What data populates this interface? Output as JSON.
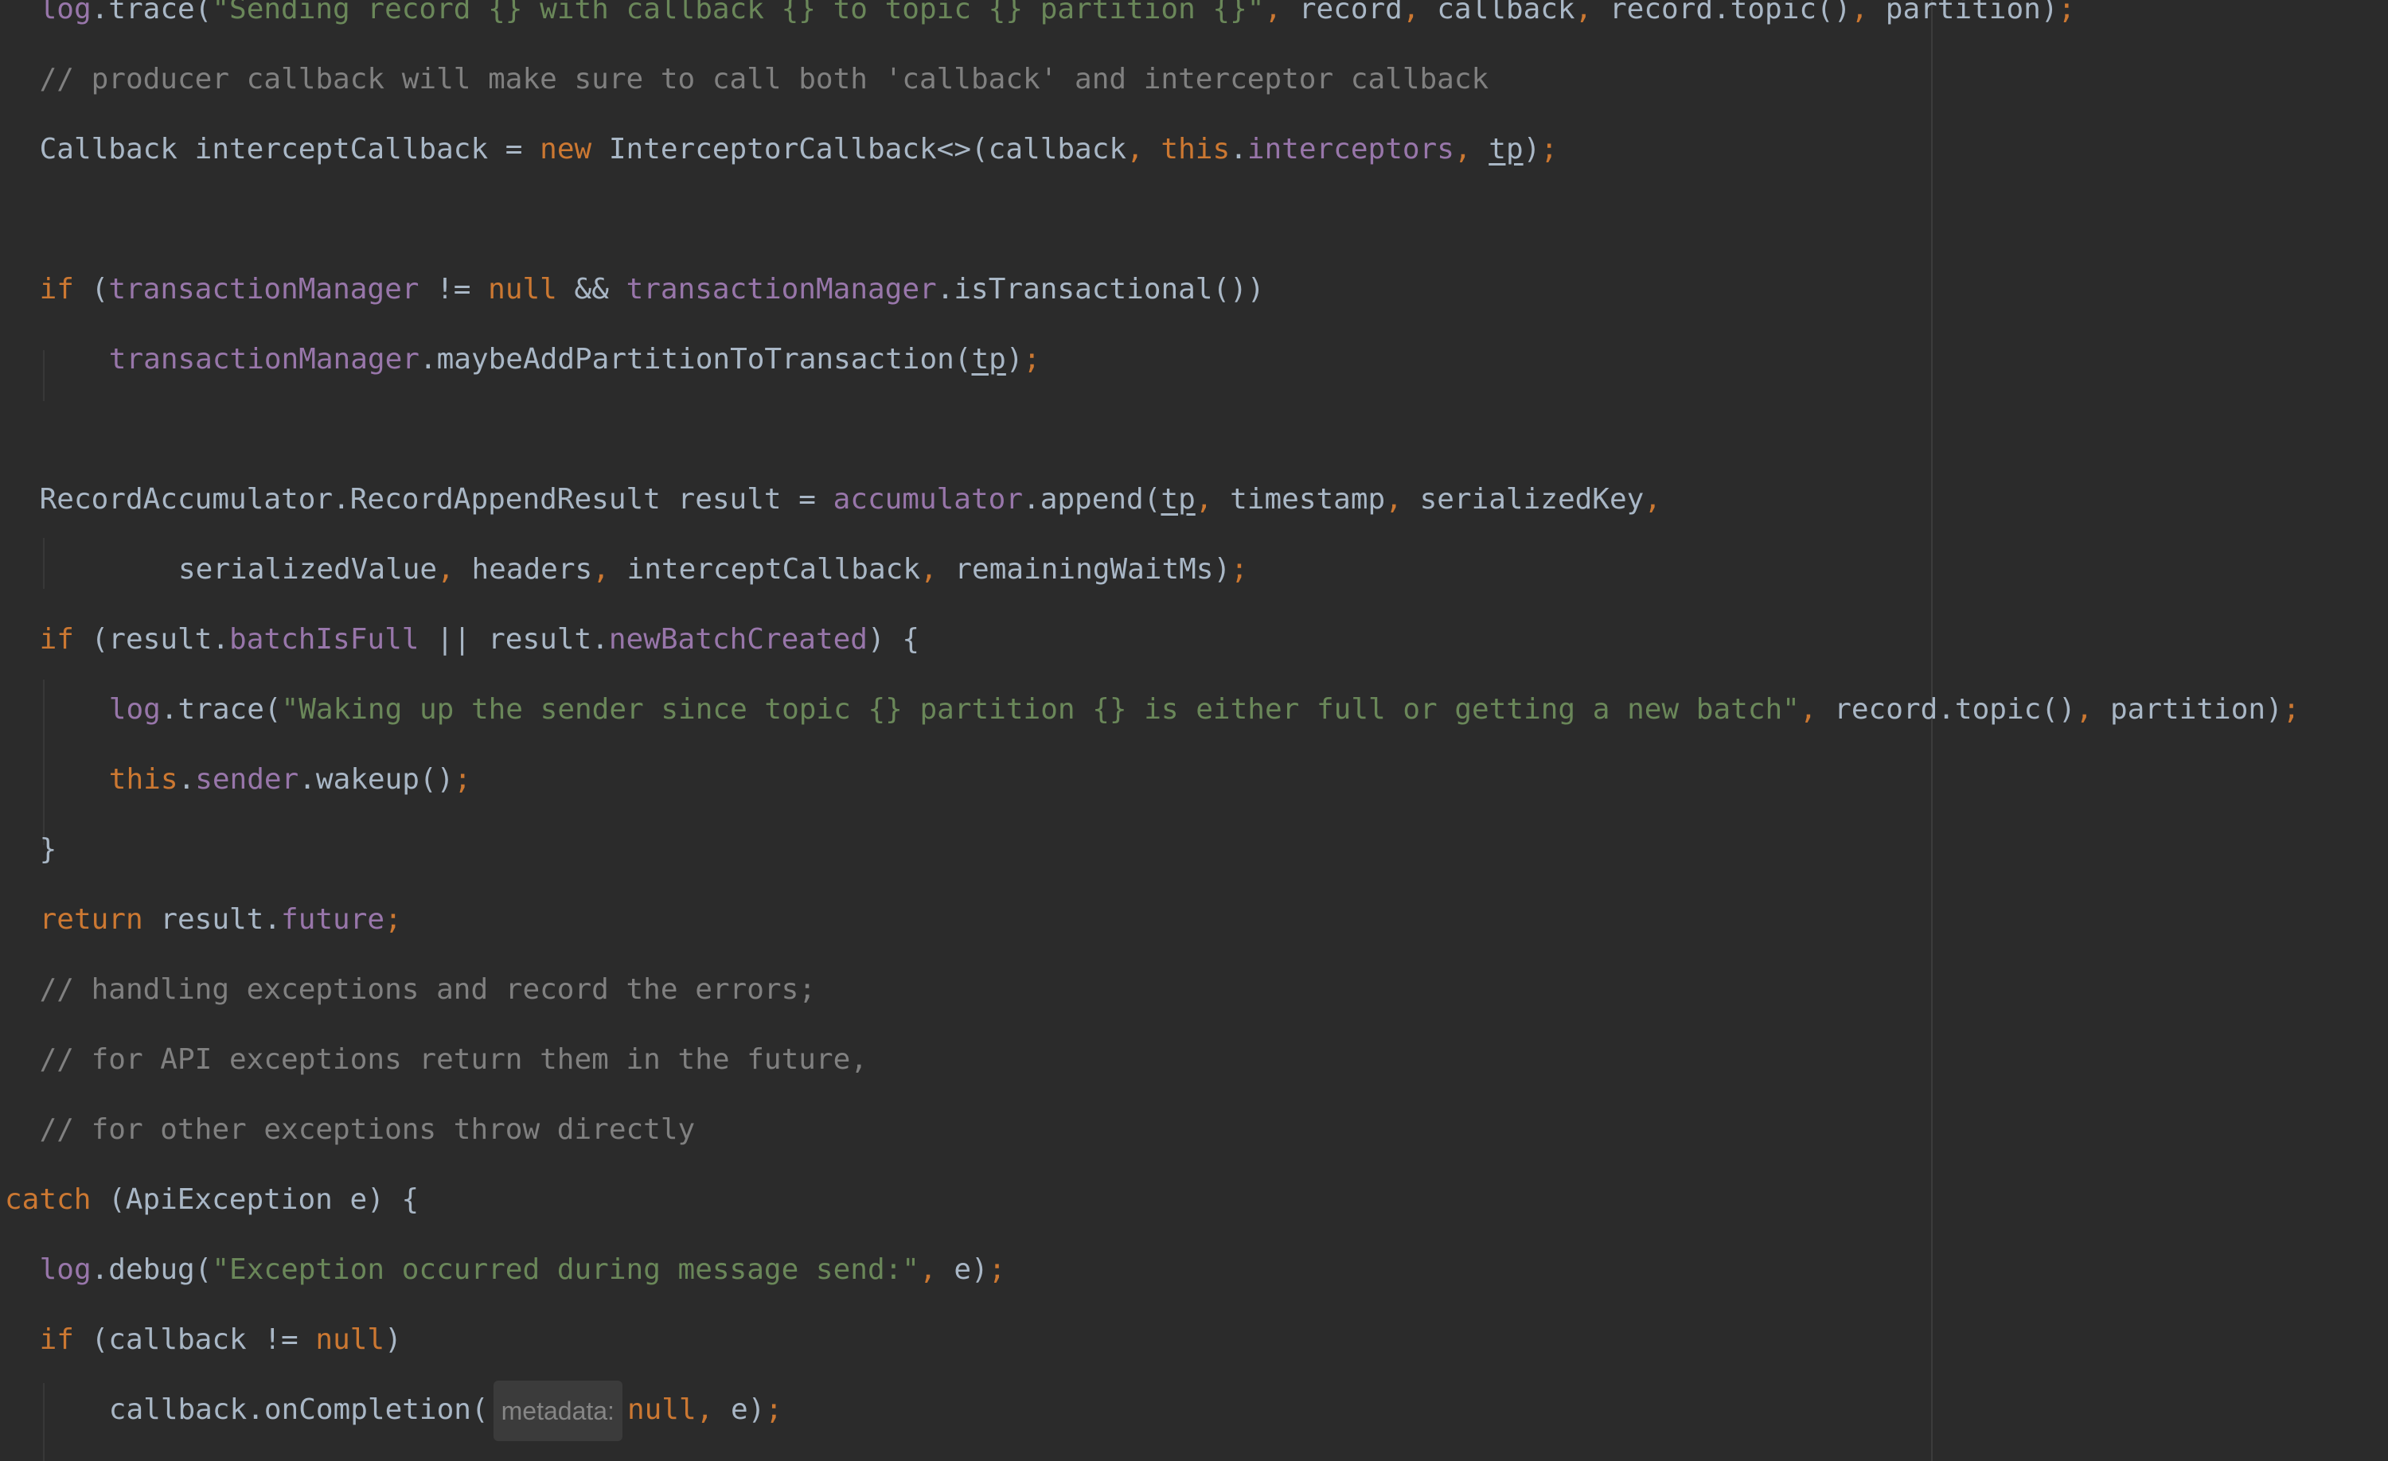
{
  "editor": {
    "colors": {
      "background": "#2b2b2b",
      "plain": "#a9b7c6",
      "keyword": "#cc7832",
      "field": "#9876aa",
      "string": "#6a8759",
      "comment": "#808080",
      "hint_background": "#3b3b3b",
      "hint_text": "#868686"
    },
    "lines": [
      {
        "indent": "  ",
        "tokens": [
          {
            "t": "field",
            "s": "log"
          },
          {
            "t": "plain",
            "s": ".trace("
          },
          {
            "t": "string",
            "s": "\"Sending record {} with callback {} to topic {} partition {}\""
          },
          {
            "t": "punct",
            "s": ", "
          },
          {
            "t": "plain",
            "s": "record"
          },
          {
            "t": "punct",
            "s": ", "
          },
          {
            "t": "plain",
            "s": "callback"
          },
          {
            "t": "punct",
            "s": ", "
          },
          {
            "t": "plain",
            "s": "record.topic()"
          },
          {
            "t": "punct",
            "s": ", "
          },
          {
            "t": "plain",
            "s": "partition)"
          },
          {
            "t": "punct",
            "s": ";"
          }
        ]
      },
      {
        "indent": "  ",
        "tokens": [
          {
            "t": "comment",
            "s": "// producer callback will make sure to call both 'callback' and interceptor callback"
          }
        ]
      },
      {
        "indent": "  ",
        "tokens": [
          {
            "t": "plain",
            "s": "Callback interceptCallback = "
          },
          {
            "t": "keyword",
            "s": "new "
          },
          {
            "t": "plain",
            "s": "InterceptorCallback<>(callback"
          },
          {
            "t": "punct",
            "s": ", "
          },
          {
            "t": "keyword",
            "s": "this"
          },
          {
            "t": "plain",
            "s": "."
          },
          {
            "t": "field",
            "s": "interceptors"
          },
          {
            "t": "punct",
            "s": ", "
          },
          {
            "t": "underline",
            "s": "tp"
          },
          {
            "t": "plain",
            "s": ")"
          },
          {
            "t": "punct",
            "s": ";"
          }
        ]
      },
      {
        "indent": "",
        "tokens": []
      },
      {
        "indent": "  ",
        "tokens": [
          {
            "t": "keyword",
            "s": "if "
          },
          {
            "t": "plain",
            "s": "("
          },
          {
            "t": "field",
            "s": "transactionManager"
          },
          {
            "t": "plain",
            "s": " != "
          },
          {
            "t": "keyword",
            "s": "null"
          },
          {
            "t": "plain",
            "s": " && "
          },
          {
            "t": "field",
            "s": "transactionManager"
          },
          {
            "t": "plain",
            "s": ".isTransactional())"
          }
        ]
      },
      {
        "indent": "      ",
        "tokens": [
          {
            "t": "field",
            "s": "transactionManager"
          },
          {
            "t": "plain",
            "s": ".maybeAddPartitionToTransaction("
          },
          {
            "t": "underline",
            "s": "tp"
          },
          {
            "t": "plain",
            "s": ")"
          },
          {
            "t": "punct",
            "s": ";"
          }
        ]
      },
      {
        "indent": "",
        "tokens": []
      },
      {
        "indent": "  ",
        "tokens": [
          {
            "t": "plain",
            "s": "RecordAccumulator.RecordAppendResult result = "
          },
          {
            "t": "field",
            "s": "accumulator"
          },
          {
            "t": "plain",
            "s": ".append("
          },
          {
            "t": "underline",
            "s": "tp"
          },
          {
            "t": "punct",
            "s": ", "
          },
          {
            "t": "plain",
            "s": "timestamp"
          },
          {
            "t": "punct",
            "s": ", "
          },
          {
            "t": "plain",
            "s": "serializedKey"
          },
          {
            "t": "punct",
            "s": ","
          }
        ]
      },
      {
        "indent": "          ",
        "tokens": [
          {
            "t": "plain",
            "s": "serializedValue"
          },
          {
            "t": "punct",
            "s": ", "
          },
          {
            "t": "plain",
            "s": "headers"
          },
          {
            "t": "punct",
            "s": ", "
          },
          {
            "t": "plain",
            "s": "interceptCallback"
          },
          {
            "t": "punct",
            "s": ", "
          },
          {
            "t": "plain",
            "s": "remainingWaitMs)"
          },
          {
            "t": "punct",
            "s": ";"
          }
        ]
      },
      {
        "indent": "  ",
        "tokens": [
          {
            "t": "keyword",
            "s": "if "
          },
          {
            "t": "plain",
            "s": "(result."
          },
          {
            "t": "field",
            "s": "batchIsFull"
          },
          {
            "t": "plain",
            "s": " || result."
          },
          {
            "t": "field",
            "s": "newBatchCreated"
          },
          {
            "t": "plain",
            "s": ") {"
          }
        ]
      },
      {
        "indent": "      ",
        "tokens": [
          {
            "t": "field",
            "s": "log"
          },
          {
            "t": "plain",
            "s": ".trace("
          },
          {
            "t": "string",
            "s": "\"Waking up the sender since topic {} partition {} is either full or getting a new batch\""
          },
          {
            "t": "punct",
            "s": ", "
          },
          {
            "t": "plain",
            "s": "record.topic()"
          },
          {
            "t": "punct",
            "s": ", "
          },
          {
            "t": "plain",
            "s": "partition)"
          },
          {
            "t": "punct",
            "s": ";"
          }
        ]
      },
      {
        "indent": "      ",
        "tokens": [
          {
            "t": "keyword",
            "s": "this"
          },
          {
            "t": "plain",
            "s": "."
          },
          {
            "t": "field",
            "s": "sender"
          },
          {
            "t": "plain",
            "s": ".wakeup()"
          },
          {
            "t": "punct",
            "s": ";"
          }
        ]
      },
      {
        "indent": "  ",
        "tokens": [
          {
            "t": "plain",
            "s": "}"
          }
        ]
      },
      {
        "indent": "  ",
        "tokens": [
          {
            "t": "keyword",
            "s": "return "
          },
          {
            "t": "plain",
            "s": "result."
          },
          {
            "t": "field",
            "s": "future"
          },
          {
            "t": "punct",
            "s": ";"
          }
        ]
      },
      {
        "indent": "  ",
        "tokens": [
          {
            "t": "comment",
            "s": "// handling exceptions and record the errors;"
          }
        ]
      },
      {
        "indent": "  ",
        "tokens": [
          {
            "t": "comment",
            "s": "// for API exceptions return them in the future,"
          }
        ]
      },
      {
        "indent": "  ",
        "tokens": [
          {
            "t": "comment",
            "s": "// for other exceptions throw directly"
          }
        ]
      },
      {
        "indent": "",
        "tokens": [
          {
            "t": "keyword",
            "s": "catch "
          },
          {
            "t": "plain",
            "s": "(ApiException e) {"
          }
        ]
      },
      {
        "indent": "  ",
        "tokens": [
          {
            "t": "field",
            "s": "log"
          },
          {
            "t": "plain",
            "s": ".debug("
          },
          {
            "t": "string",
            "s": "\"Exception occurred during message send:\""
          },
          {
            "t": "punct",
            "s": ", "
          },
          {
            "t": "plain",
            "s": "e)"
          },
          {
            "t": "punct",
            "s": ";"
          }
        ]
      },
      {
        "indent": "  ",
        "tokens": [
          {
            "t": "keyword",
            "s": "if "
          },
          {
            "t": "plain",
            "s": "(callback != "
          },
          {
            "t": "keyword",
            "s": "null"
          },
          {
            "t": "plain",
            "s": ")"
          }
        ]
      },
      {
        "indent": "      ",
        "tokens": [
          {
            "t": "plain",
            "s": "callback.onCompletion("
          },
          {
            "t": "hint",
            "s": "metadata:"
          },
          {
            "t": "keyword",
            "s": "null"
          },
          {
            "t": "punct",
            "s": ", "
          },
          {
            "t": "plain",
            "s": "e)"
          },
          {
            "t": "punct",
            "s": ";"
          }
        ]
      }
    ]
  }
}
